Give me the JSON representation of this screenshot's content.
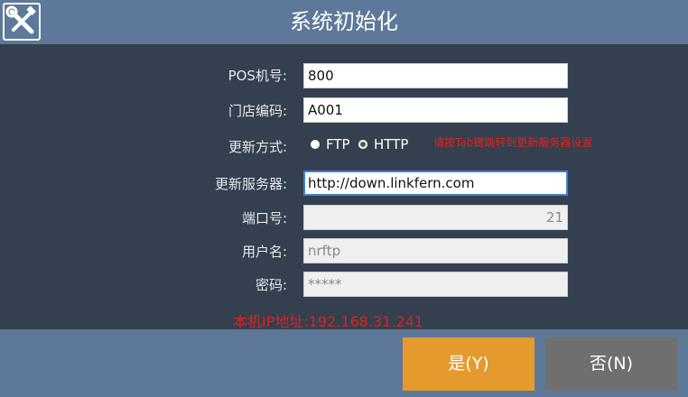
{
  "window": {
    "title": "系统初始化",
    "icon": "tools-icon"
  },
  "form": {
    "pos_label": "POS机号:",
    "pos_value": "800",
    "store_label": "门店编码:",
    "store_value": "A001",
    "update_mode_label": "更新方式:",
    "options": [
      {
        "label": "FTP",
        "selected": false
      },
      {
        "label": "HTTP",
        "selected": true
      }
    ],
    "hint": "请按Tab键跳转到更新服务器设置",
    "server_label": "更新服务器:",
    "server_value": "http://down.linkfern.com",
    "port_label": "端口号:",
    "port_value": "21",
    "user_label": "用户名:",
    "user_value": "nrftp",
    "password_label": "密码:",
    "password_value": "*****"
  },
  "status": {
    "ip_text": "本机IP地址:192.168.31.241"
  },
  "buttons": {
    "yes": "是(Y)",
    "no": "否(N)"
  },
  "colors": {
    "titlebar": "#5e7899",
    "body": "#34404f",
    "yes": "#e59a2e",
    "no": "#6f6f6f",
    "hint": "#e0201c"
  }
}
